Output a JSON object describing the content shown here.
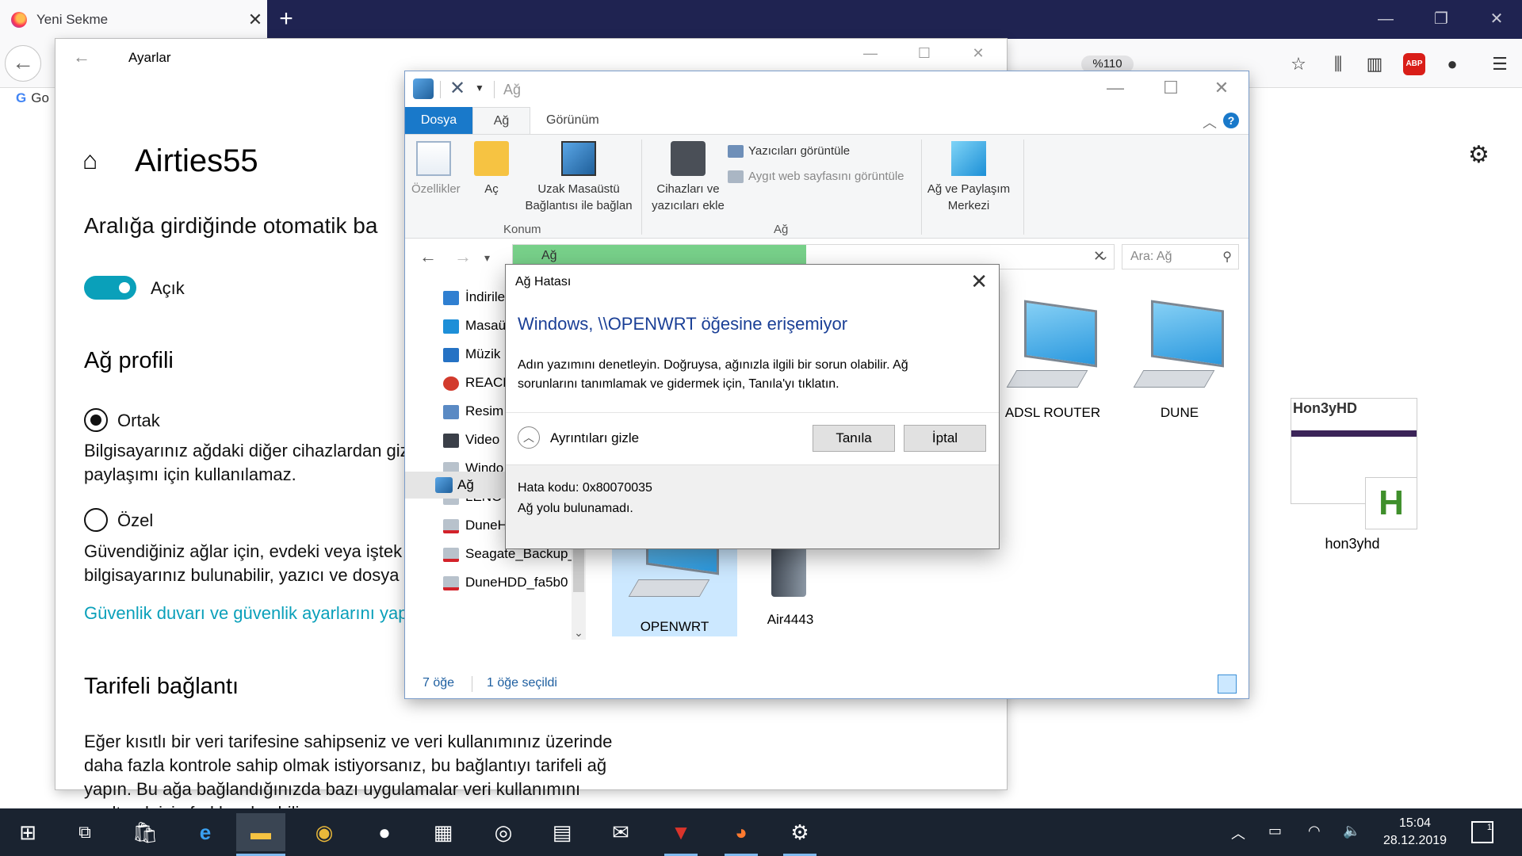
{
  "browser": {
    "tab_title": "Yeni Sekme",
    "new_tab": "+",
    "zoom": "%110",
    "bookmark_label": "Go",
    "abp": "ABP"
  },
  "settings": {
    "window_title": "Ayarlar",
    "heading": "Airties55",
    "auto_connect_label": "Aralığa girdiğinde otomatik ba",
    "toggle_label": "Açık",
    "toggle_on": true,
    "profile_heading": "Ağ profili",
    "public_label": "Ortak",
    "public_desc_1": "Bilgisayarınız ağdaki diğer cihazlardan giz",
    "public_desc_2": "paylaşımı için kullanılamaz.",
    "private_label": "Özel",
    "private_desc_1": "Güvendiğiniz ağlar için, evdeki veya iştek",
    "private_desc_2": "bilgisayarınız bulunabilir, yazıcı ve dosya",
    "firewall_link": "Güvenlik duvarı ve güvenlik ayarlarını yap",
    "metered_heading": "Tarifeli bağlantı",
    "metered_desc": [
      "Eğer kısıtlı bir veri tarifesine sahipseniz ve veri kullanımınız üzerinde",
      "daha fazla kontrole sahip olmak istiyorsanız, bu bağlantıyı tarifeli ağ",
      "yapın. Bu ağa bağlandığınızda bazı uygulamalar veri kullanımını",
      "azaltmak için farklı çalışabilir."
    ]
  },
  "explorer": {
    "title_path": "Ağ",
    "tabs": {
      "file": "Dosya",
      "network": "Ağ",
      "view": "Görünüm"
    },
    "ribbon": {
      "properties": "Özellikler",
      "open": "Aç",
      "remote_1": "Uzak Masaüstü",
      "remote_2": "Bağlantısı ile bağlan",
      "group_location": "Konum",
      "add_devices_1": "Cihazları ve",
      "add_devices_2": "yazıcıları ekle",
      "view_printers": "Yazıcıları görüntüle",
      "view_web_page": "Aygıt web sayfasını görüntüle",
      "group_network": "Ağ",
      "sharing_1": "Ağ ve Paylaşım",
      "sharing_2": "Merkezi"
    },
    "address": "Ağ",
    "search_placeholder": "Ara: Ağ",
    "nav_items": [
      "İndirile",
      "Masaü",
      "Müzik",
      "REACH",
      "Resim",
      "Video",
      "Windo",
      "LENOV",
      "DuneH",
      "Seagate_Backup_",
      "DuneHDD_fa5b0"
    ],
    "nav_network": "Ağ",
    "devices": [
      "ADSL ROUTER",
      "DUNE",
      "OPENWRT",
      "Air4443"
    ],
    "status_items": "7 öğe",
    "status_selected": "1 öğe seçildi"
  },
  "dialog": {
    "title": "Ağ Hatası",
    "heading": "Windows, \\\\OPENWRT öğesine erişemiyor",
    "body_1": "Adın yazımını denetleyin. Doğruysa, ağınızla ilgili bir sorun olabilir. Ağ",
    "body_2": "sorunlarını tanımlamak ve gidermek için, Tanıla'yı tıklatın.",
    "details_toggle": "Ayrıntıları gizle",
    "diagnose_button": "Tanıla",
    "cancel_button": "İptal",
    "error_code": "Hata kodu: 0x80070035",
    "error_text": "Ağ yolu bulunamadı."
  },
  "desktop": {
    "icon_label": "hon3yhd",
    "thumb_logo": "Hon3yHD",
    "thumb_letter": "H"
  },
  "taskbar": {
    "time": "15:04",
    "date": "28.12.2019",
    "notification_count": "1"
  },
  "colors": {
    "accent_teal": "#0aa0ba",
    "explorer_blue": "#1979ca",
    "dialog_heading": "#1a3f96",
    "firefox_titlebar": "#1f2351",
    "taskbar": "#1a2330"
  }
}
